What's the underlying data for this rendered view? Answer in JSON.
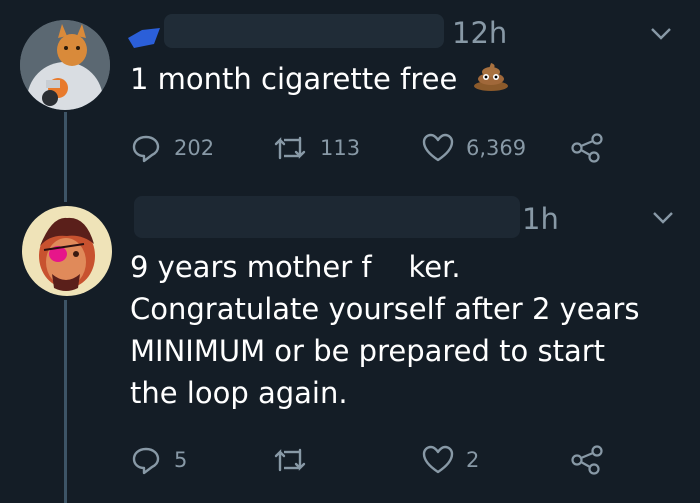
{
  "tweets": [
    {
      "time": "12h",
      "text": "1 month cigarette free",
      "emoji": "pile-of-poo",
      "stats": {
        "replies": "202",
        "retweets": "113",
        "likes": "6,369"
      }
    },
    {
      "time": "1h",
      "lines": [
        "9 years mother f    ker.",
        "Congratulate yourself after 2 years",
        "MINIMUM or be prepared to start",
        "the loop again."
      ],
      "stats": {
        "replies": "5",
        "retweets": "",
        "likes": "2"
      }
    }
  ],
  "icons": {
    "reply": "reply-icon",
    "retweet": "retweet-icon",
    "like": "heart-icon",
    "share": "share-icon",
    "chevron": "chevron-down-icon"
  },
  "colors": {
    "background": "#141d26",
    "text": "#ffffff",
    "muted": "#8899a6",
    "thread_line": "#3d5466",
    "verified_blue": "#1da1f2"
  }
}
